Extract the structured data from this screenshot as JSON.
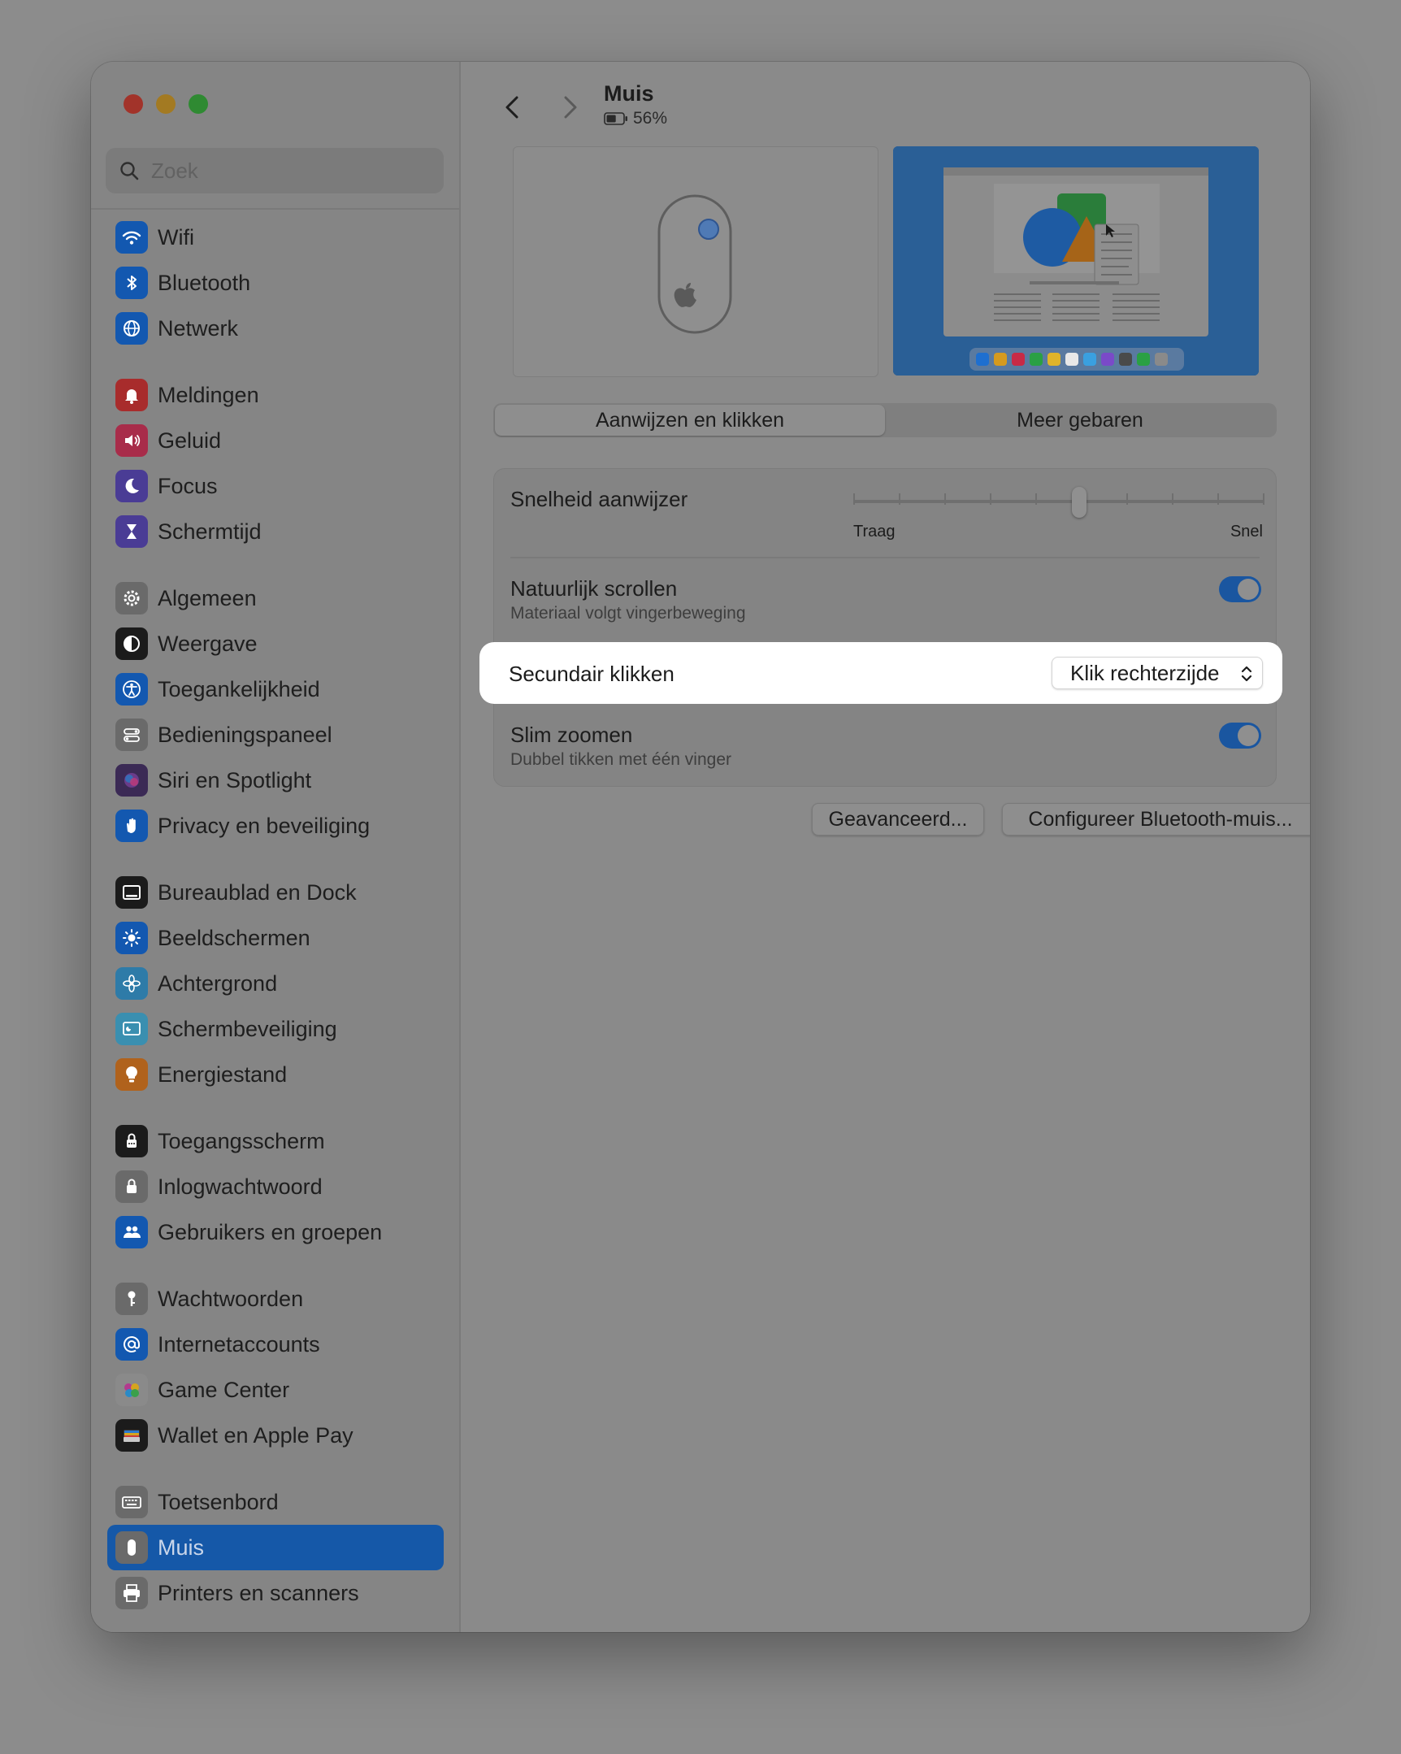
{
  "window": {
    "traffic_colors": [
      "#a2332a",
      "#a37a22",
      "#2f8a32"
    ]
  },
  "search": {
    "placeholder": "Zoek"
  },
  "sidebar": {
    "groups": [
      [
        {
          "label": "Wifi",
          "icon": "wifi-icon",
          "color": "#1358b0"
        },
        {
          "label": "Bluetooth",
          "icon": "bluetooth-icon",
          "color": "#1358b0"
        },
        {
          "label": "Netwerk",
          "icon": "globe-icon",
          "color": "#1358b0"
        }
      ],
      [
        {
          "label": "Meldingen",
          "icon": "bell-icon",
          "color": "#a82c2c"
        },
        {
          "label": "Geluid",
          "icon": "speaker-icon",
          "color": "#a82c4a"
        },
        {
          "label": "Focus",
          "icon": "moon-icon",
          "color": "#4a3c95"
        },
        {
          "label": "Schermtijd",
          "icon": "hourglass-icon",
          "color": "#4a3c95"
        }
      ],
      [
        {
          "label": "Algemeen",
          "icon": "gear-icon",
          "color": "#6a6a6a"
        },
        {
          "label": "Weergave",
          "icon": "appearance-icon",
          "color": "#1b1b1b"
        },
        {
          "label": "Toegankelijkheid",
          "icon": "accessibility-icon",
          "color": "#1358b0"
        },
        {
          "label": "Bedieningspaneel",
          "icon": "control-center-icon",
          "color": "#6a6a6a"
        },
        {
          "label": "Siri en Spotlight",
          "icon": "siri-icon",
          "color": "#3b2a55"
        },
        {
          "label": "Privacy en beveiliging",
          "icon": "hand-icon",
          "color": "#1358b0"
        }
      ],
      [
        {
          "label": "Bureaublad en Dock",
          "icon": "dock-icon",
          "color": "#1b1b1b"
        },
        {
          "label": "Beeldschermen",
          "icon": "sun-icon",
          "color": "#1358b0"
        },
        {
          "label": "Achtergrond",
          "icon": "flower-icon",
          "color": "#2e7ba8"
        },
        {
          "label": "Schermbeveiliging",
          "icon": "screensaver-icon",
          "color": "#3a8fb0"
        },
        {
          "label": "Energiestand",
          "icon": "lightbulb-icon",
          "color": "#b0621c"
        }
      ],
      [
        {
          "label": "Toegangsscherm",
          "icon": "lock-screen-icon",
          "color": "#1b1b1b"
        },
        {
          "label": "Inlogwachtwoord",
          "icon": "lock-icon",
          "color": "#6a6a6a"
        },
        {
          "label": "Gebruikers en groepen",
          "icon": "users-icon",
          "color": "#1358b0"
        }
      ],
      [
        {
          "label": "Wachtwoorden",
          "icon": "key-icon",
          "color": "#6a6a6a"
        },
        {
          "label": "Internetaccounts",
          "icon": "at-icon",
          "color": "#1358b0"
        },
        {
          "label": "Game Center",
          "icon": "game-center-icon",
          "color": "#8a8a8a"
        },
        {
          "label": "Wallet en Apple Pay",
          "icon": "wallet-icon",
          "color": "#1b1b1b"
        }
      ],
      [
        {
          "label": "Toetsenbord",
          "icon": "keyboard-icon",
          "color": "#6a6a6a"
        },
        {
          "label": "Muis",
          "icon": "mouse-icon",
          "color": "#6a6a6a",
          "selected": true
        },
        {
          "label": "Printers en scanners",
          "icon": "printer-icon",
          "color": "#6a6a6a"
        }
      ]
    ]
  },
  "header": {
    "title": "Muis",
    "battery": "56%",
    "battery_level": 0.56
  },
  "tabs": [
    "Aanwijzen en klikken",
    "Meer gebaren"
  ],
  "settings": {
    "speed": {
      "label": "Snelheid aanwijzer",
      "min_label": "Traag",
      "max_label": "Snel",
      "value": 0.55
    },
    "natural_scroll": {
      "label": "Natuurlijk scrollen",
      "sub": "Materiaal volgt vingerbeweging",
      "on": true
    },
    "secondary_click": {
      "label": "Secundair klikken",
      "value": "Klik rechterzijde"
    },
    "smart_zoom": {
      "label": "Slim zoomen",
      "sub": "Dubbel tikken met één vinger",
      "on": true
    }
  },
  "buttons": {
    "advanced": "Geavanceerd...",
    "configure": "Configureer Bluetooth-muis...",
    "help": "?"
  }
}
